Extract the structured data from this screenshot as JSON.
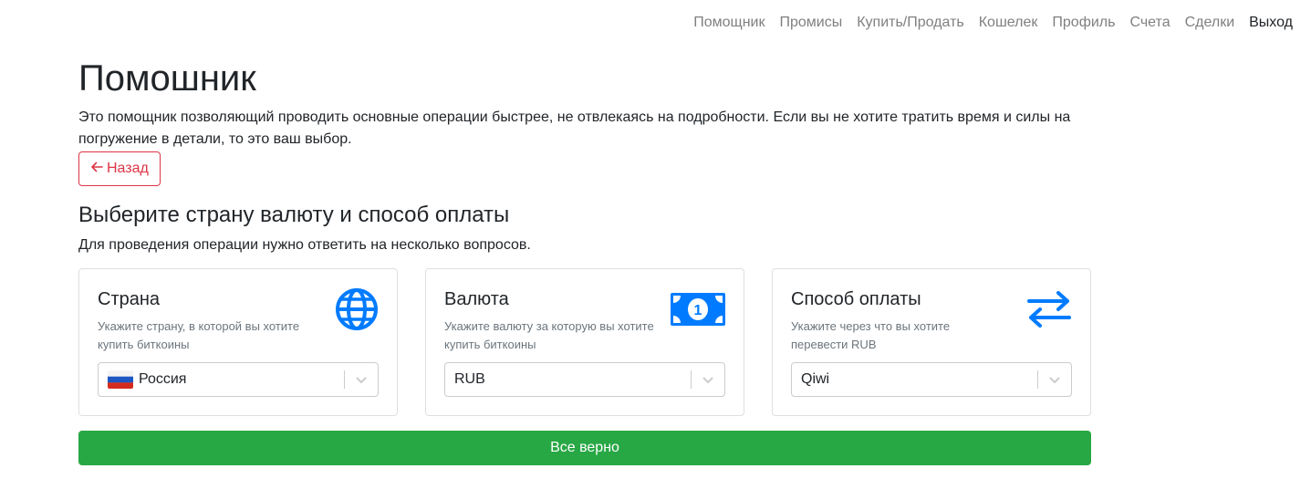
{
  "nav": {
    "items": [
      {
        "label": "Помощник"
      },
      {
        "label": "Промисы"
      },
      {
        "label": "Купить/Продать"
      },
      {
        "label": "Кошелек"
      },
      {
        "label": "Профиль"
      },
      {
        "label": "Счета"
      },
      {
        "label": "Сделки"
      },
      {
        "label": "Выход"
      }
    ]
  },
  "page": {
    "title": "Помошник",
    "intro": "Это помощник позволяющий проводить основные операции быстрее, не отвлекаясь на подробности. Если вы не хотите тратить время и силы на погружение в детали, то это ваш выбор.",
    "back_label": "Назад"
  },
  "section": {
    "title": "Выберите страну валюту и способ оплаты",
    "subtitle": "Для проведения операции нужно ответить на несколько вопросов."
  },
  "cards": [
    {
      "title": "Страна",
      "hint": "Укажите страну, в которой вы хотите купить биткоины",
      "icon": "globe-icon",
      "selected": "Россия"
    },
    {
      "title": "Валюта",
      "hint": "Укажите валюту за которую вы хотите купить биткоины",
      "icon": "money-bill-icon",
      "selected": "RUB"
    },
    {
      "title": "Способ оплаты",
      "hint": "Укажите через что вы хотите перевести RUB",
      "icon": "exchange-arrows-icon",
      "selected": "Qiwi"
    }
  ],
  "submit_label": "Все верно",
  "colors": {
    "accent_blue": "#007bff",
    "danger": "#dc3545",
    "success": "#28a745"
  }
}
